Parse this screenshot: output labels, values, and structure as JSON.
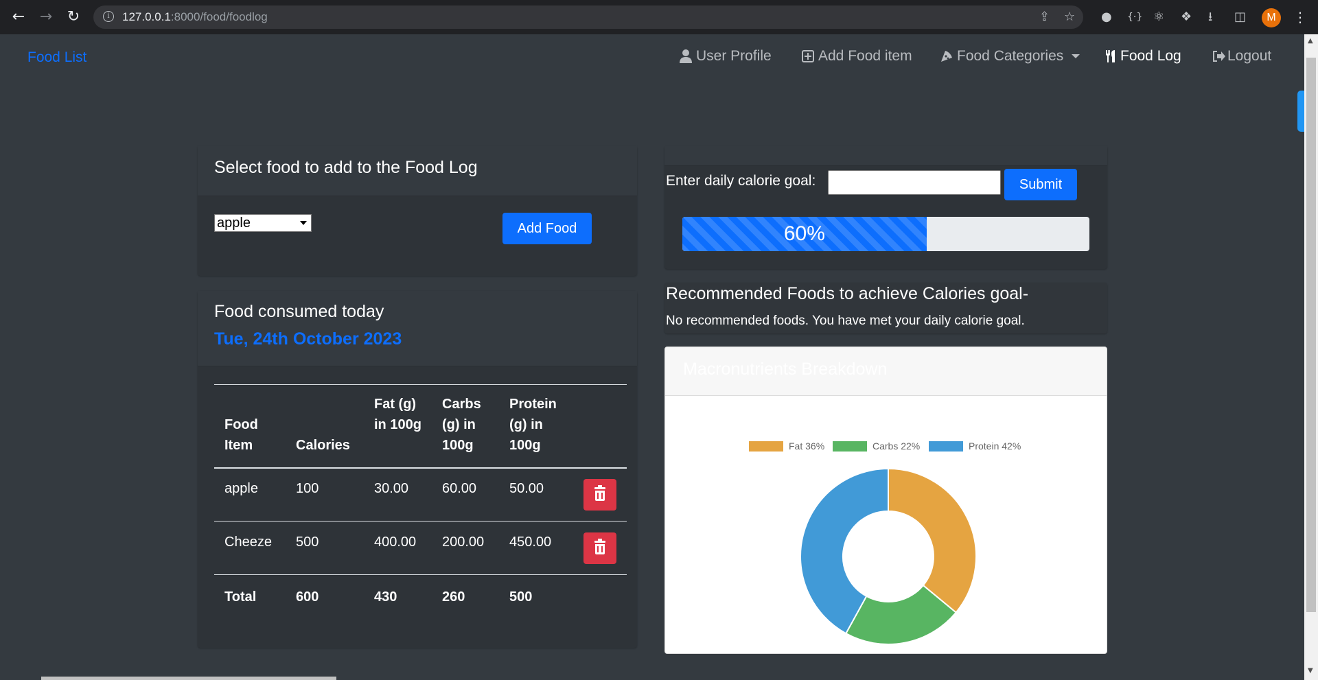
{
  "browser": {
    "url_host": "127.0.0.1",
    "url_path": ":8000/food/foodlog",
    "profile_initial": "M"
  },
  "navbar": {
    "brand": "Food List",
    "items": [
      {
        "label": "User Profile",
        "icon": "user-icon"
      },
      {
        "label": "Add Food item",
        "icon": "plus-square-icon"
      },
      {
        "label": "Food Categories",
        "icon": "pizza-icon"
      },
      {
        "label": "Food Log",
        "icon": "utensils-icon"
      },
      {
        "label": "Logout",
        "icon": "sign-out-icon"
      }
    ]
  },
  "add_food": {
    "title": "Select food to add to the Food Log",
    "selected": "apple",
    "button": "Add Food"
  },
  "consumed": {
    "title": "Food consumed today",
    "date": "Tue, 24th October 2023",
    "headers": [
      "Food Item",
      "Calories",
      "Fat (g) in 100g",
      "Carbs (g) in 100g",
      "Protein (g) in 100g"
    ],
    "rows": [
      {
        "food": "apple",
        "calories": "100",
        "fat": "30.00",
        "carbs": "60.00",
        "protein": "50.00"
      },
      {
        "food": "Cheeze",
        "calories": "500",
        "fat": "400.00",
        "carbs": "200.00",
        "protein": "450.00"
      }
    ],
    "total": {
      "label": "Total",
      "calories": "600",
      "fat": "430",
      "carbs": "260",
      "protein": "500"
    }
  },
  "goal": {
    "label": "Enter daily calorie goal:",
    "input_value": "",
    "submit": "Submit",
    "progress_percent": 60,
    "progress_label": "60%"
  },
  "recommended": {
    "title": "Recommended Foods to achieve Calories goal-",
    "message": "No recommended foods. You have met your daily calorie goal."
  },
  "macros": {
    "title": "Macronutrients Breakdown",
    "legend": [
      {
        "label": "Fat 36%",
        "color": "#e5a441"
      },
      {
        "label": "Carbs 22%",
        "color": "#58b562"
      },
      {
        "label": "Protein 42%",
        "color": "#419ad7"
      }
    ]
  },
  "chart_data": {
    "type": "pie",
    "variant": "doughnut",
    "categories": [
      "Fat",
      "Carbs",
      "Protein"
    ],
    "values": [
      36,
      22,
      42
    ],
    "colors": [
      "#e5a441",
      "#58b562",
      "#419ad7"
    ],
    "legend_position": "top"
  }
}
